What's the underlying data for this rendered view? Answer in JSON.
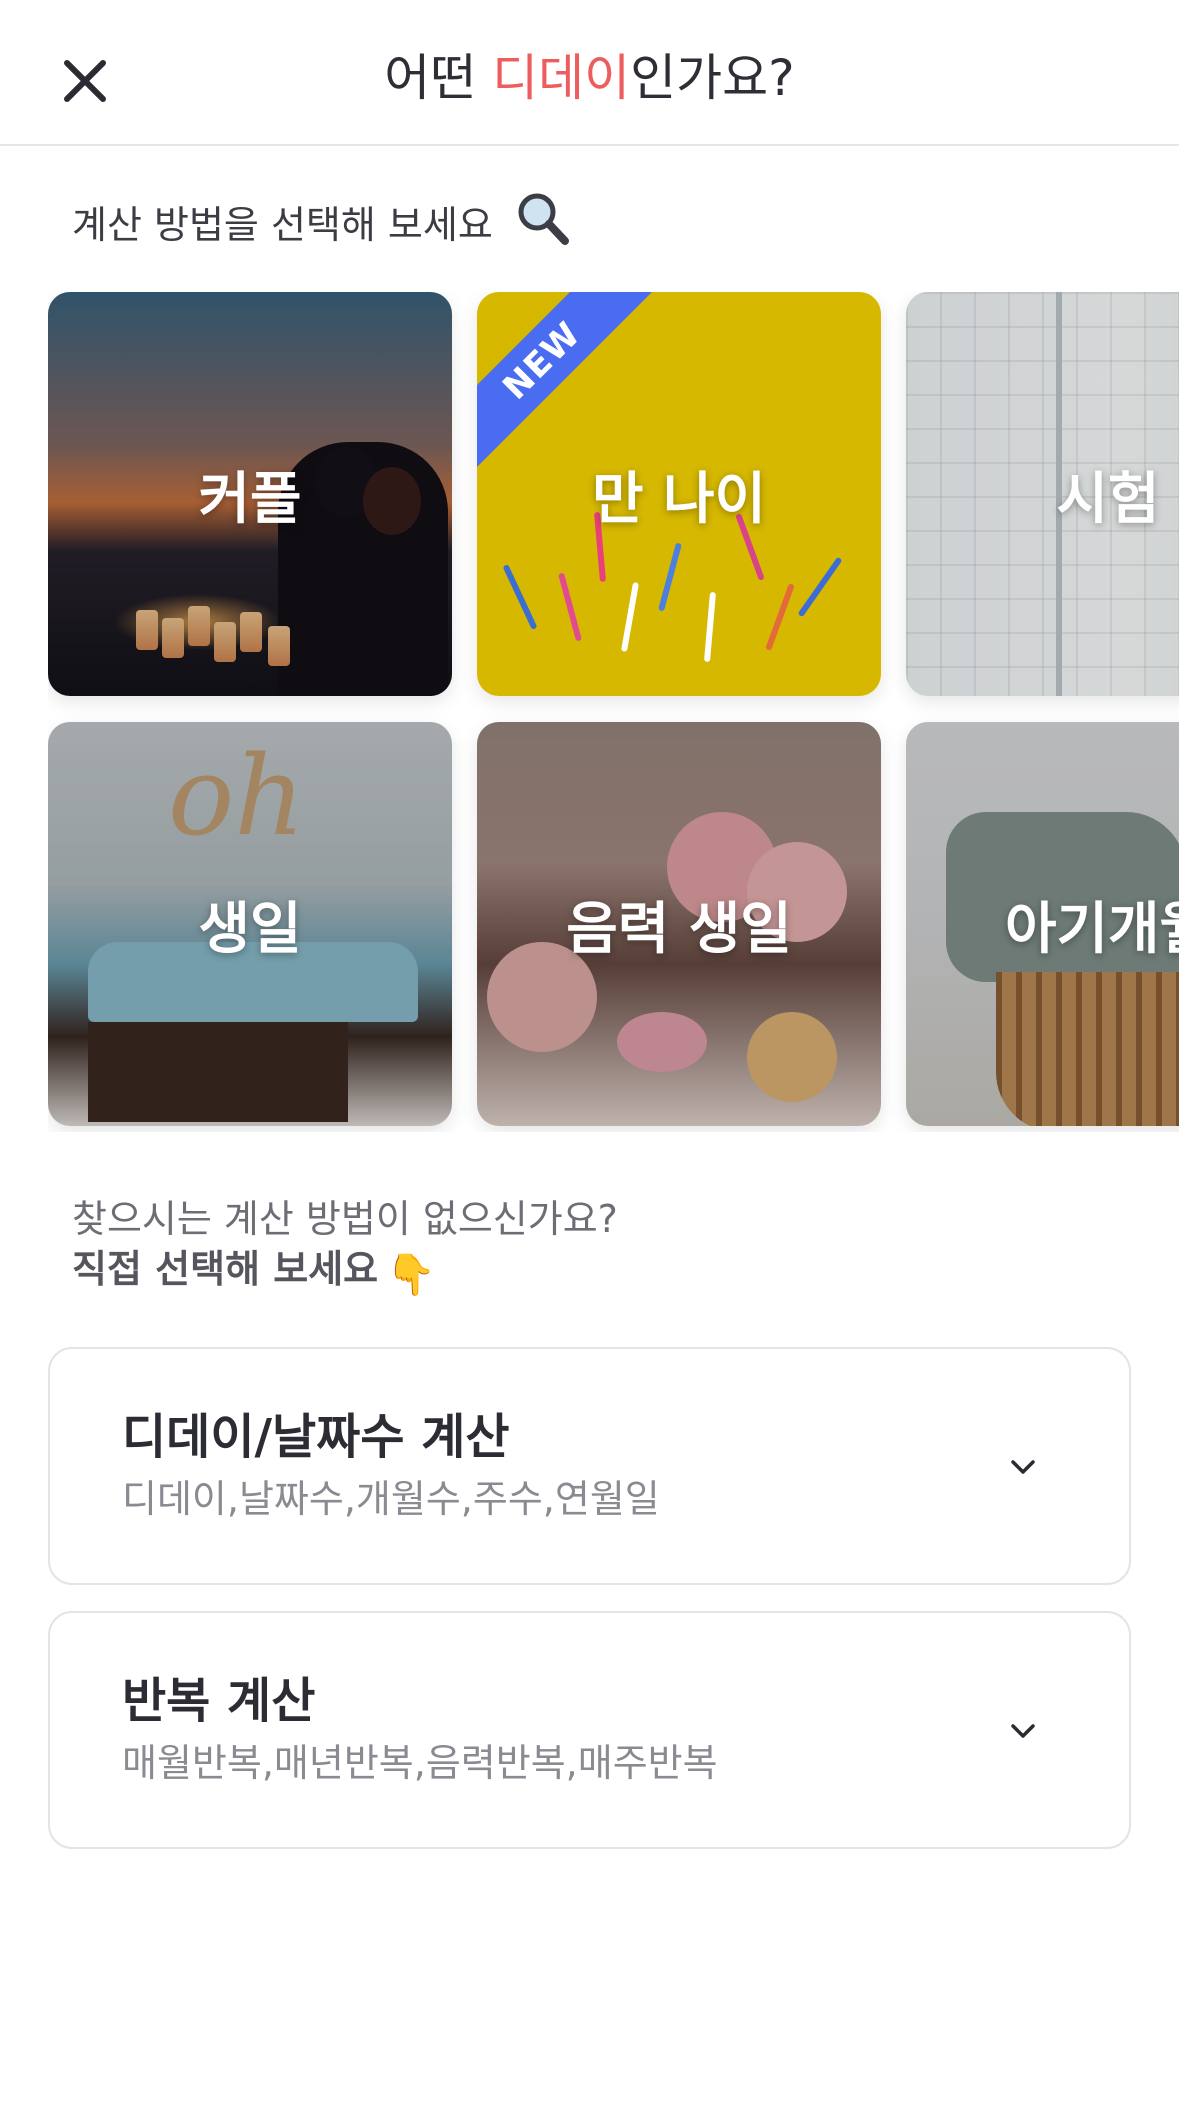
{
  "header": {
    "title_prefix": "어떤 ",
    "title_accent": "디데이",
    "title_suffix": "인가요?",
    "accent_color": "#ee5d5d"
  },
  "section": {
    "label": "계산 방법을 선택해 보세요",
    "icon": "magnifier-icon"
  },
  "cards": [
    {
      "label": "커플",
      "image": "couple-sunset-photo"
    },
    {
      "label": "만 나이",
      "image": "birthday-candles-photo",
      "badge": "NEW",
      "badge_color": "#4a6cf1"
    },
    {
      "label": "시험",
      "image": "planner-notebook-photo"
    },
    {
      "label": "생일",
      "image": "blue-cake-photo"
    },
    {
      "label": "음력 생일",
      "image": "flower-cake-photo"
    },
    {
      "label": "아기개월",
      "image": "baby-basket-photo"
    }
  ],
  "prompt": {
    "line1": "찾으시는 계산 방법이 없으신가요?",
    "line2": "직접 선택해 보세요",
    "icon": "pointing-down-hand-icon"
  },
  "options": [
    {
      "title": "디데이/날짜수 계산",
      "subtitle": "디데이,날짜수,개월수,주수,연월일"
    },
    {
      "title": "반복 계산",
      "subtitle": "매월반복,매년반복,음력반복,매주반복"
    }
  ]
}
